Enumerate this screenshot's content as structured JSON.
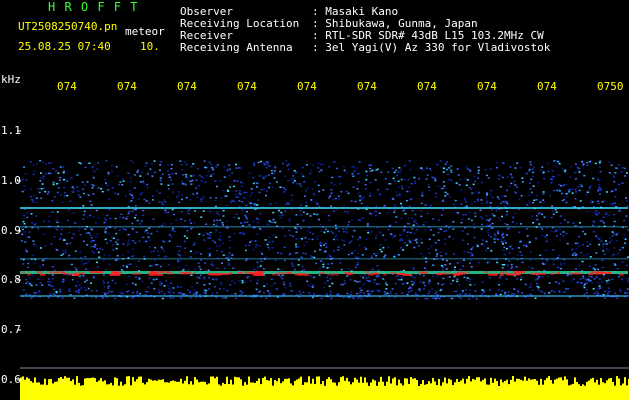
{
  "header": {
    "brand": "H R O F F T",
    "filename": "UT2508250740.pn",
    "tag": "meteor",
    "datetime": "25.08.25 07:40",
    "interval": "10.",
    "info_rows": [
      {
        "label": "Observer",
        "value": ": Masaki Kano"
      },
      {
        "label": "Receiving Location",
        "value": ": Shibukawa, Gunma, Japan"
      },
      {
        "label": "Receiver",
        "value": ": RTL-SDR SDR# 43dB L15 103.2MHz CW"
      },
      {
        "label": "Receiving Antenna",
        "value": ": 3el Yagi(V) Az 330 for Vladivostok"
      }
    ]
  },
  "axis": {
    "y_unit": "kHz",
    "y_ticks": [
      "1.1",
      "1.0",
      "0.9",
      "0.8",
      "0.7",
      "0.6"
    ],
    "x_ticks": [
      "074",
      "074",
      "074",
      "074",
      "074",
      "074",
      "074",
      "074",
      "074",
      "0750"
    ]
  },
  "colors": {
    "background": "#000000",
    "label_white": "#ffffff",
    "label_yellow": "#ffff00",
    "brand_green": "#33ff33",
    "noise_blue": "#1e3cc8",
    "echo_red": "#ff2020",
    "signal_cyan": "#40e0ff"
  }
}
